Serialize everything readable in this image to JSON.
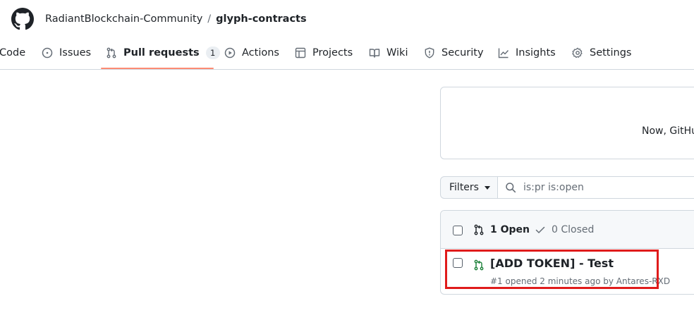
{
  "repo": {
    "owner": "RadiantBlockchain-Community",
    "separator": "/",
    "name": "glyph-contracts"
  },
  "nav": {
    "tabs": [
      {
        "label": "Code",
        "icon": "code-icon"
      },
      {
        "label": "Issues",
        "icon": "issue-opened-icon"
      },
      {
        "label": "Pull requests",
        "icon": "git-pull-request-icon",
        "counter": "1",
        "selected": true
      },
      {
        "label": "Actions",
        "icon": "play-icon"
      },
      {
        "label": "Projects",
        "icon": "table-icon"
      },
      {
        "label": "Wiki",
        "icon": "book-icon"
      },
      {
        "label": "Security",
        "icon": "shield-icon"
      },
      {
        "label": "Insights",
        "icon": "graph-icon"
      },
      {
        "label": "Settings",
        "icon": "gear-icon"
      }
    ]
  },
  "banner": {
    "text": "Now, GitHu"
  },
  "filters": {
    "button_label": "Filters",
    "search_value": "is:pr is:open"
  },
  "list": {
    "open_label": "1 Open",
    "closed_label": "0 Closed",
    "items": [
      {
        "title": "[ADD TOKEN] - Test",
        "meta": "#1 opened 2 minutes ago by Antares-RXD",
        "status_color": "#1a7f37"
      }
    ]
  },
  "colors": {
    "accent_underline": "#fd8c73",
    "open_green": "#1a7f37",
    "highlight_red": "#e01b1b"
  }
}
